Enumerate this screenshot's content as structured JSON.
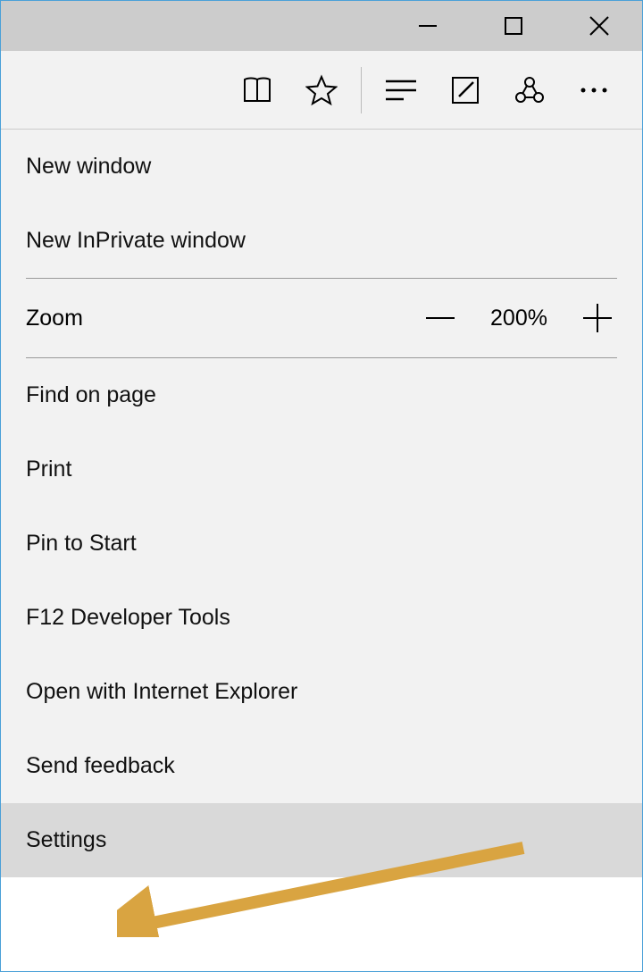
{
  "menu": {
    "items": [
      {
        "label": "New window"
      },
      {
        "label": "New InPrivate window"
      }
    ],
    "zoom": {
      "label": "Zoom",
      "value": "200%"
    },
    "items2": [
      {
        "label": "Find on page"
      },
      {
        "label": "Print"
      },
      {
        "label": "Pin to Start"
      },
      {
        "label": "F12 Developer Tools"
      },
      {
        "label": "Open with Internet Explorer"
      },
      {
        "label": "Send feedback"
      },
      {
        "label": "Settings"
      }
    ]
  },
  "annotation": {
    "color": "#d9a441"
  }
}
